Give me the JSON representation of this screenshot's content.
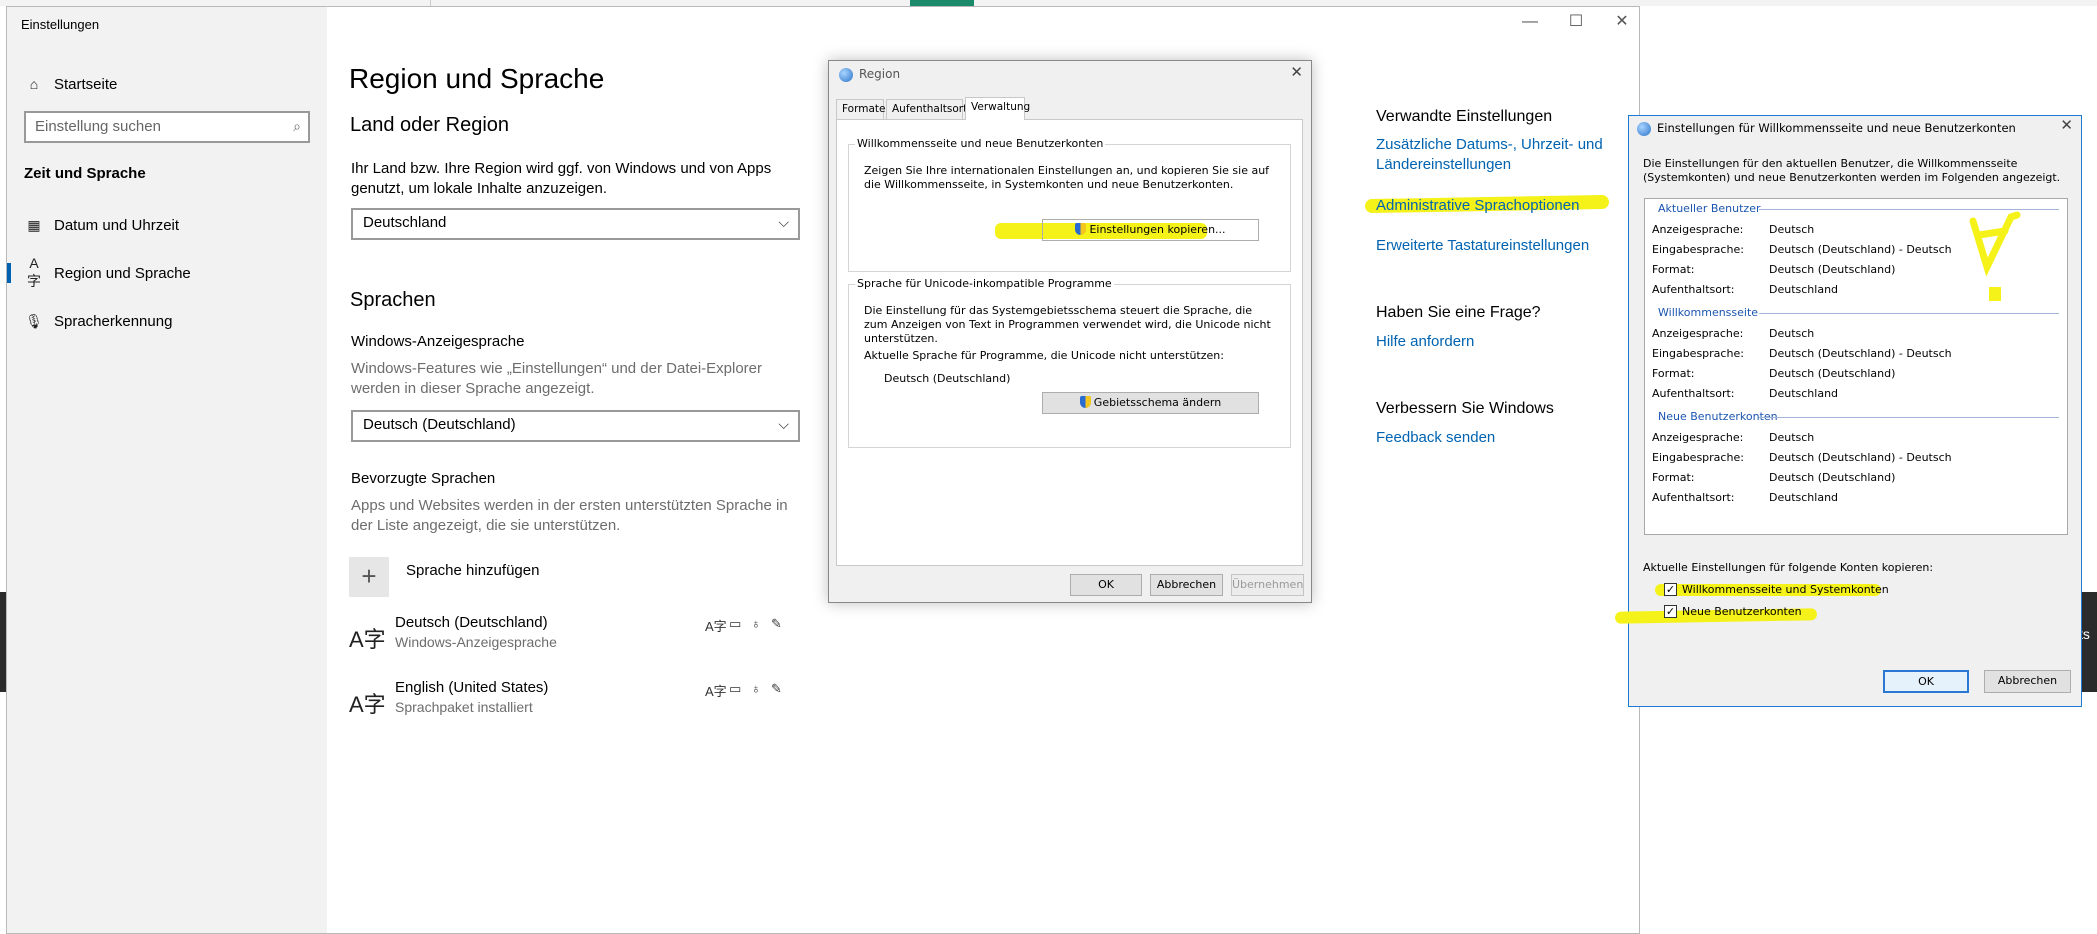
{
  "settings": {
    "window_title": "Einstellungen",
    "nav": {
      "home": "Startseite",
      "search_placeholder": "Einstellung suchen",
      "section": "Zeit und Sprache",
      "items": [
        {
          "label": "Datum und Uhrzeit",
          "icon": "calendar-clock-icon"
        },
        {
          "label": "Region und Sprache",
          "icon": "language-icon",
          "active": true
        },
        {
          "label": "Spracherkennung",
          "icon": "microphone-icon"
        }
      ]
    },
    "page_title": "Region und Sprache",
    "country": {
      "heading": "Land oder Region",
      "desc": "Ihr Land bzw. Ihre Region wird ggf. von Windows und von Apps genutzt, um lokale Inhalte anzuzeigen.",
      "value": "Deutschland"
    },
    "languages": {
      "heading": "Sprachen",
      "display_label": "Windows-Anzeigesprache",
      "display_desc": "Windows-Features wie „Einstellungen“ und der Datei-Explorer werden in dieser Sprache angezeigt.",
      "display_value": "Deutsch (Deutschland)",
      "preferred_label": "Bevorzugte Sprachen",
      "preferred_desc": "Apps und Websites werden in der ersten unterstützten Sprache in der Liste angezeigt, die sie unterstützen.",
      "add_label": "Sprache hinzufügen",
      "list": [
        {
          "name": "Deutsch (Deutschland)",
          "sub": "Windows-Anzeigesprache"
        },
        {
          "name": "English (United States)",
          "sub": "Sprachpaket installiert"
        }
      ]
    },
    "related": {
      "heading": "Verwandte Einstellungen",
      "link1": "Zusätzliche Datums-, Uhrzeit- und Ländereinstellungen",
      "link2": "Administrative Sprachoptionen",
      "link3": "Erweiterte Tastatureinstellungen",
      "question_heading": "Haben Sie eine Frage?",
      "help_link": "Hilfe anfordern",
      "improve_heading": "Verbessern Sie Windows",
      "feedback_link": "Feedback senden"
    }
  },
  "region_dialog": {
    "title": "Region",
    "tabs": [
      "Formate",
      "Aufenthaltsort",
      "Verwaltung"
    ],
    "active_tab": "Verwaltung",
    "welcome_group": {
      "legend": "Willkommensseite und neue Benutzerkonten",
      "text": "Zeigen Sie Ihre internationalen Einstellungen an, und kopieren Sie sie auf die Willkommensseite, in Systemkonten und neue Benutzerkonten.",
      "button": "Einstellungen kopieren..."
    },
    "unicode_group": {
      "legend": "Sprache für Unicode-inkompatible Programme",
      "text": "Die Einstellung für das Systemgebietsschema steuert die Sprache, die zum Anzeigen von Text in Programmen verwendet wird, die Unicode nicht unterstützen.",
      "current_label": "Aktuelle Sprache für Programme, die Unicode nicht unterstützen:",
      "current_value": "Deutsch (Deutschland)",
      "button": "Gebietsschema ändern"
    },
    "buttons": {
      "ok": "OK",
      "cancel": "Abbrechen",
      "apply": "Übernehmen"
    }
  },
  "welcome_dialog": {
    "title": "Einstellungen für Willkommensseite und neue Benutzerkonten",
    "intro": "Die Einstellungen für den aktuellen Benutzer, die Willkommensseite (Systemkonten) und neue Benutzerkonten werden im Folgenden angezeigt.",
    "sections": [
      {
        "heading": "Aktueller Benutzer",
        "rows": [
          {
            "k": "Anzeigesprache:",
            "v": "Deutsch"
          },
          {
            "k": "Eingabesprache:",
            "v": "Deutsch (Deutschland) - Deutsch"
          },
          {
            "k": "Format:",
            "v": "Deutsch (Deutschland)"
          },
          {
            "k": "Aufenthaltsort:",
            "v": "Deutschland"
          }
        ]
      },
      {
        "heading": "Willkommensseite",
        "rows": [
          {
            "k": "Anzeigesprache:",
            "v": "Deutsch"
          },
          {
            "k": "Eingabesprache:",
            "v": "Deutsch (Deutschland) - Deutsch"
          },
          {
            "k": "Format:",
            "v": "Deutsch (Deutschland)"
          },
          {
            "k": "Aufenthaltsort:",
            "v": "Deutschland"
          }
        ]
      },
      {
        "heading": "Neue Benutzerkonten",
        "rows": [
          {
            "k": "Anzeigesprache:",
            "v": "Deutsch"
          },
          {
            "k": "Eingabesprache:",
            "v": "Deutsch (Deutschland) - Deutsch"
          },
          {
            "k": "Format:",
            "v": "Deutsch (Deutschland)"
          },
          {
            "k": "Aufenthaltsort:",
            "v": "Deutschland"
          }
        ]
      }
    ],
    "copy_label": "Aktuelle Einstellungen für folgende Konten kopieren:",
    "checkbox1": "Willkommensseite und Systemkonten",
    "checkbox2": "Neue Benutzerkonten",
    "checkbox1_checked": true,
    "checkbox2_checked": true,
    "ok": "OK",
    "cancel": "Abbrechen"
  },
  "background": {
    "right_fragment": "ts"
  },
  "colors": {
    "accent": "#0063b1",
    "highlight": "#f5f21a",
    "sidebar": "#f2f2f2",
    "dialog_bg": "#f0f0f0"
  }
}
